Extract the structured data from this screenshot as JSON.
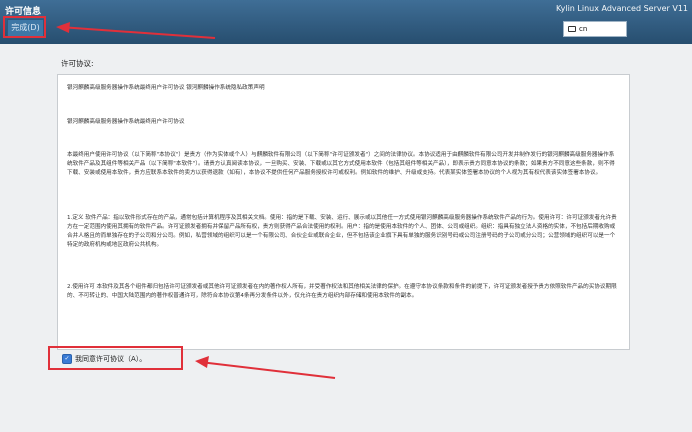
{
  "header": {
    "title": "许可信息",
    "done_label": "完成(D)",
    "product_name": "Kylin Linux Advanced Server V11",
    "keyboard_layout": "cn"
  },
  "license": {
    "label": "许可协议:",
    "paragraphs": [
      "银河麒麟高级服务器操作系统最终用户许可协议 银河麒麟操作系统隐私政策声明",
      "银河麒麟高级服务器操作系统最终用户许可协议",
      "本最终用户使用许可协议（以下简称\"本协议\"）是贵方（作为实体或个人）与麒麟软件有限公司（以下简称\"许可证颁发者\"）之间的法律协议。本协议适用于由麒麟软件有限公司开发并制作发行的银河麒麟高级服务器操作系统软件产品及其组件等相关产品（以下简称\"本软件\"）。请贵方认真阅读本协议，一旦购买、安装、下载或以其它方式使用本软件（包括其组件等相关产品），即表示贵方同意本协议的条款；如果贵方不同意这些条款，则不得下载、安装或使用本软件，贵方应联系本软件的卖方以获得退款（如有），本协议不提供任何产品服务授权许可或权利。例如软件的维护、升级或支持。代表某实体签署本协议的个人视为其有权代表该实体签署本协议。",
      "1.定义 软件产品：指以软件形式存在的产品，通常包括计算机程序及其相关文档。使用：指的是下载、安装、运行、展示或以其他任一方式使用银河麒麟高级服务器操作系统软件产品的行为。使用许可：许可证颁发者允许贵方在一定范围内使用其拥有的软件产品。许可证颁发者拥有并保留产品所有权，贵方则获得产品合法使用的权利。用户：指的是使用本软件的个人、团体、公司或组织。组织：指具有独立法人资格的实体，不包括后期收购或合并人格且的而单独存在的子公司和分公司。例如，私营领域的组织可以是一个有限公司、合伙企业或联合企业，但不包括该企业旗下具有单独的服务识别号码或公司注册号码的子公司或分公司；公营领域的组织可以是一个特定的政府机构或地区政府公共机构。",
      "2.使用许可 本软件及其各个组件都归包括许可证颁发者或其他许可证颁发者在内的著作权人所有，并受著作权法和其他相关法律的保护。在遵守本协议条款和条件的前提下，许可证颁发者授予贵方依照软件产品的买协议期限的、不可转让的、中国大陆范围内的著作权普通许可，除符合本协议第4条再分发条件以外，仅允许在贵方组织内部存储和使用本软件的副本。"
    ]
  },
  "agreement": {
    "checkbox_label": "我同意许可协议（A）。",
    "checked": true
  },
  "colors": {
    "header_bg": "#2f5d84",
    "annotation_red": "#e0303a",
    "checkbox_blue": "#3a7bd5"
  }
}
